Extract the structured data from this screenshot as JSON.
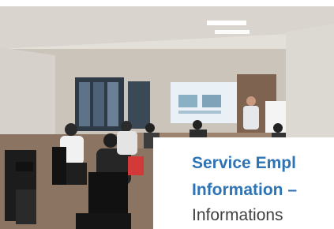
{
  "card": {
    "title_line1": "Service Empl",
    "title_line2": "Information –",
    "subtitle": "Informations"
  },
  "photo": {
    "subject": "meeting-room-presentation-photo",
    "projection_icon": "slide-projection"
  },
  "colors": {
    "title": "#2e74b5",
    "subtitle": "#404040",
    "card_background": "#ffffff",
    "wall": "#cfcac2",
    "ceiling": "#e2dfd9"
  }
}
